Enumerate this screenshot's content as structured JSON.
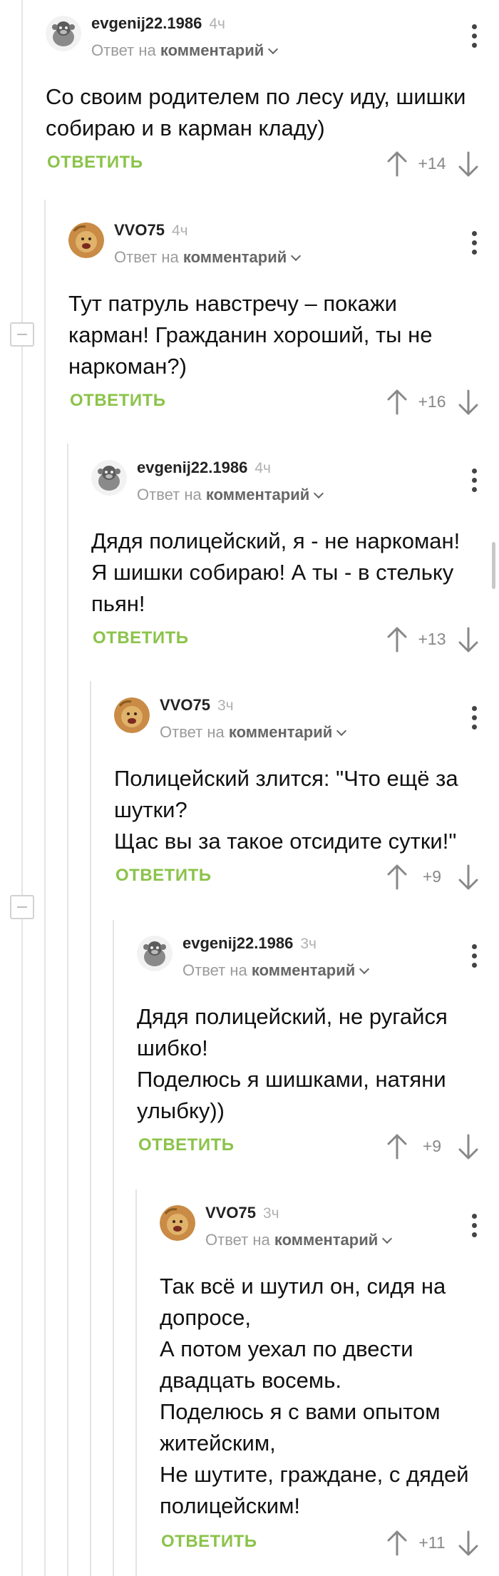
{
  "thread": {
    "reply_prefix": "Ответ на",
    "reply_target": "комментарий",
    "reply_button_label": "ОТВЕТИТЬ",
    "accent_color": "#8bc34a",
    "comments": [
      {
        "author": "evgenij22.1986",
        "time": "4ч",
        "avatar_icon": "monkey-avatar",
        "lines": [
          "Со своим родителем по лесу иду, шишки",
          "собираю и в карман кладу)"
        ],
        "score": "+14"
      },
      {
        "author": "VVO75",
        "time": "4ч",
        "avatar_icon": "lion-avatar",
        "lines": [
          "Тут патруль навстречу – покажи",
          "карман! Гражданин хороший, ты не",
          "наркоман?)"
        ],
        "score": "+16"
      },
      {
        "author": "evgenij22.1986",
        "time": "4ч",
        "avatar_icon": "monkey-avatar",
        "lines": [
          "Дядя полицейский, я - не наркоман!",
          "Я шишки собираю! А ты - в стельку",
          "пьян!"
        ],
        "score": "+13"
      },
      {
        "author": "VVO75",
        "time": "3ч",
        "avatar_icon": "lion-avatar",
        "lines": [
          "Полицейский злится: \"Что ещё за",
          "шутки?",
          "Щас вы за такое отсидите сутки!\""
        ],
        "score": "+9"
      },
      {
        "author": "evgenij22.1986",
        "time": "3ч",
        "avatar_icon": "monkey-avatar",
        "lines": [
          "Дядя полицейский, не ругайся",
          "шибко!",
          "Поделюсь я шишками, натяни",
          "улыбку))"
        ],
        "score": "+9"
      },
      {
        "author": "VVO75",
        "time": "3ч",
        "avatar_icon": "lion-avatar",
        "lines": [
          "Так всё и шутил он, сидя на",
          "допросе,",
          "А потом уехал по двести",
          "двадцать восемь.",
          "Поделюсь я с вами опытом",
          "житейским,",
          "Не шутите, граждане, с дядей",
          "полицейским!"
        ],
        "score": "+11"
      }
    ]
  }
}
